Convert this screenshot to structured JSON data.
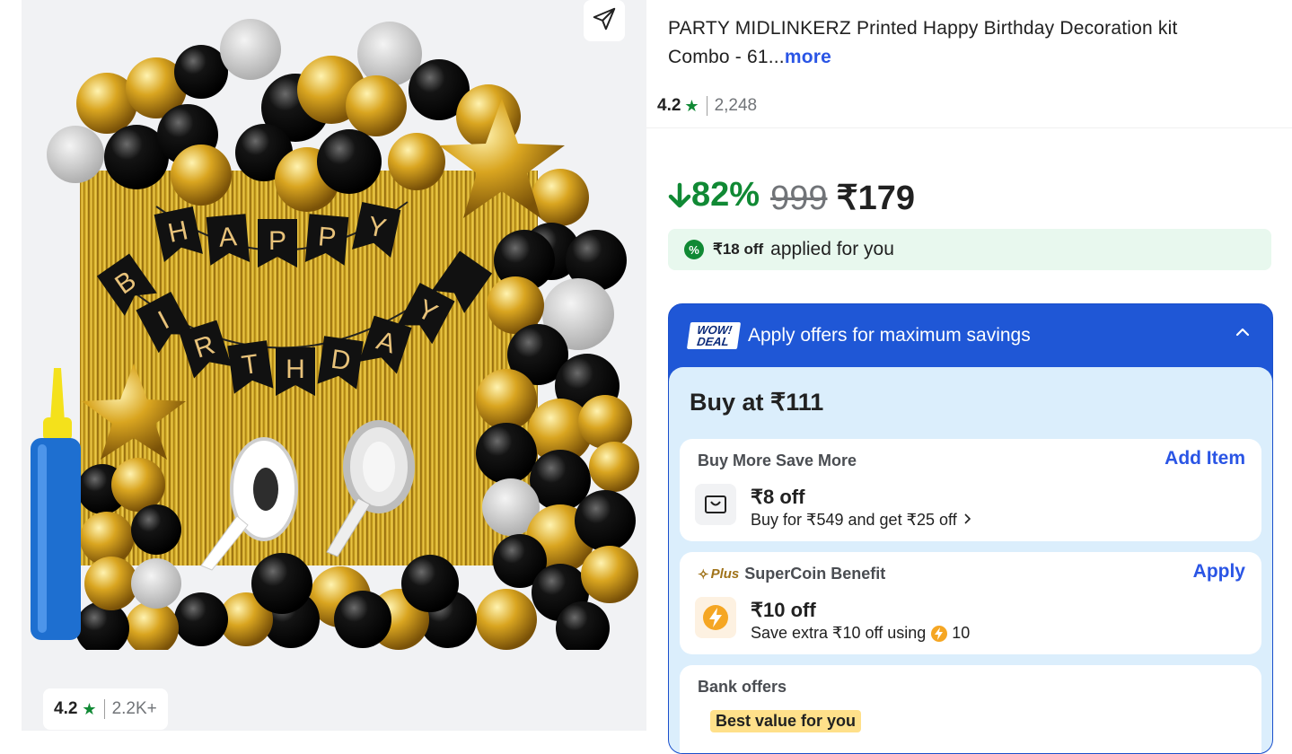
{
  "product": {
    "title": "PARTY MIDLINKERZ Printed Happy Birthday Decoration kit Combo - 61...",
    "more_label": "more",
    "rating": "4.2",
    "rating_count": "2,248",
    "image_rating": "4.2",
    "image_rating_count": "2.2K+",
    "image_banner_text": "HAPPY BIRTHDAY"
  },
  "price": {
    "discount": "82%",
    "mrp": "999",
    "selling": "₹179"
  },
  "applied": {
    "amount": "₹18 off",
    "text": "applied for you"
  },
  "offers": {
    "badge_line1": "WOW!",
    "badge_line2": "DEAL",
    "header": "Apply offers for maximum savings",
    "buy_at": "Buy at ₹111",
    "cards": [
      {
        "title": "Buy More Save More",
        "action": "Add Item",
        "amount": "₹8 off",
        "desc": "Buy for ₹549 and get ₹25 off",
        "icon": "bag-icon"
      },
      {
        "badge": "Plus",
        "title": "SuperCoin Benefit",
        "action": "Apply",
        "amount": "₹10 off",
        "desc": "Save extra ₹10 off using",
        "coin_count": "10",
        "icon": "supercoin-icon"
      },
      {
        "title": "Bank offers",
        "tag": "Best value for you"
      }
    ]
  },
  "colors": {
    "accent_blue": "#2a55e5",
    "discount_green": "#108934",
    "offer_header_blue": "#1f57d6",
    "offer_body": "#dbeefc",
    "applied_bg": "#e8f8ee"
  }
}
